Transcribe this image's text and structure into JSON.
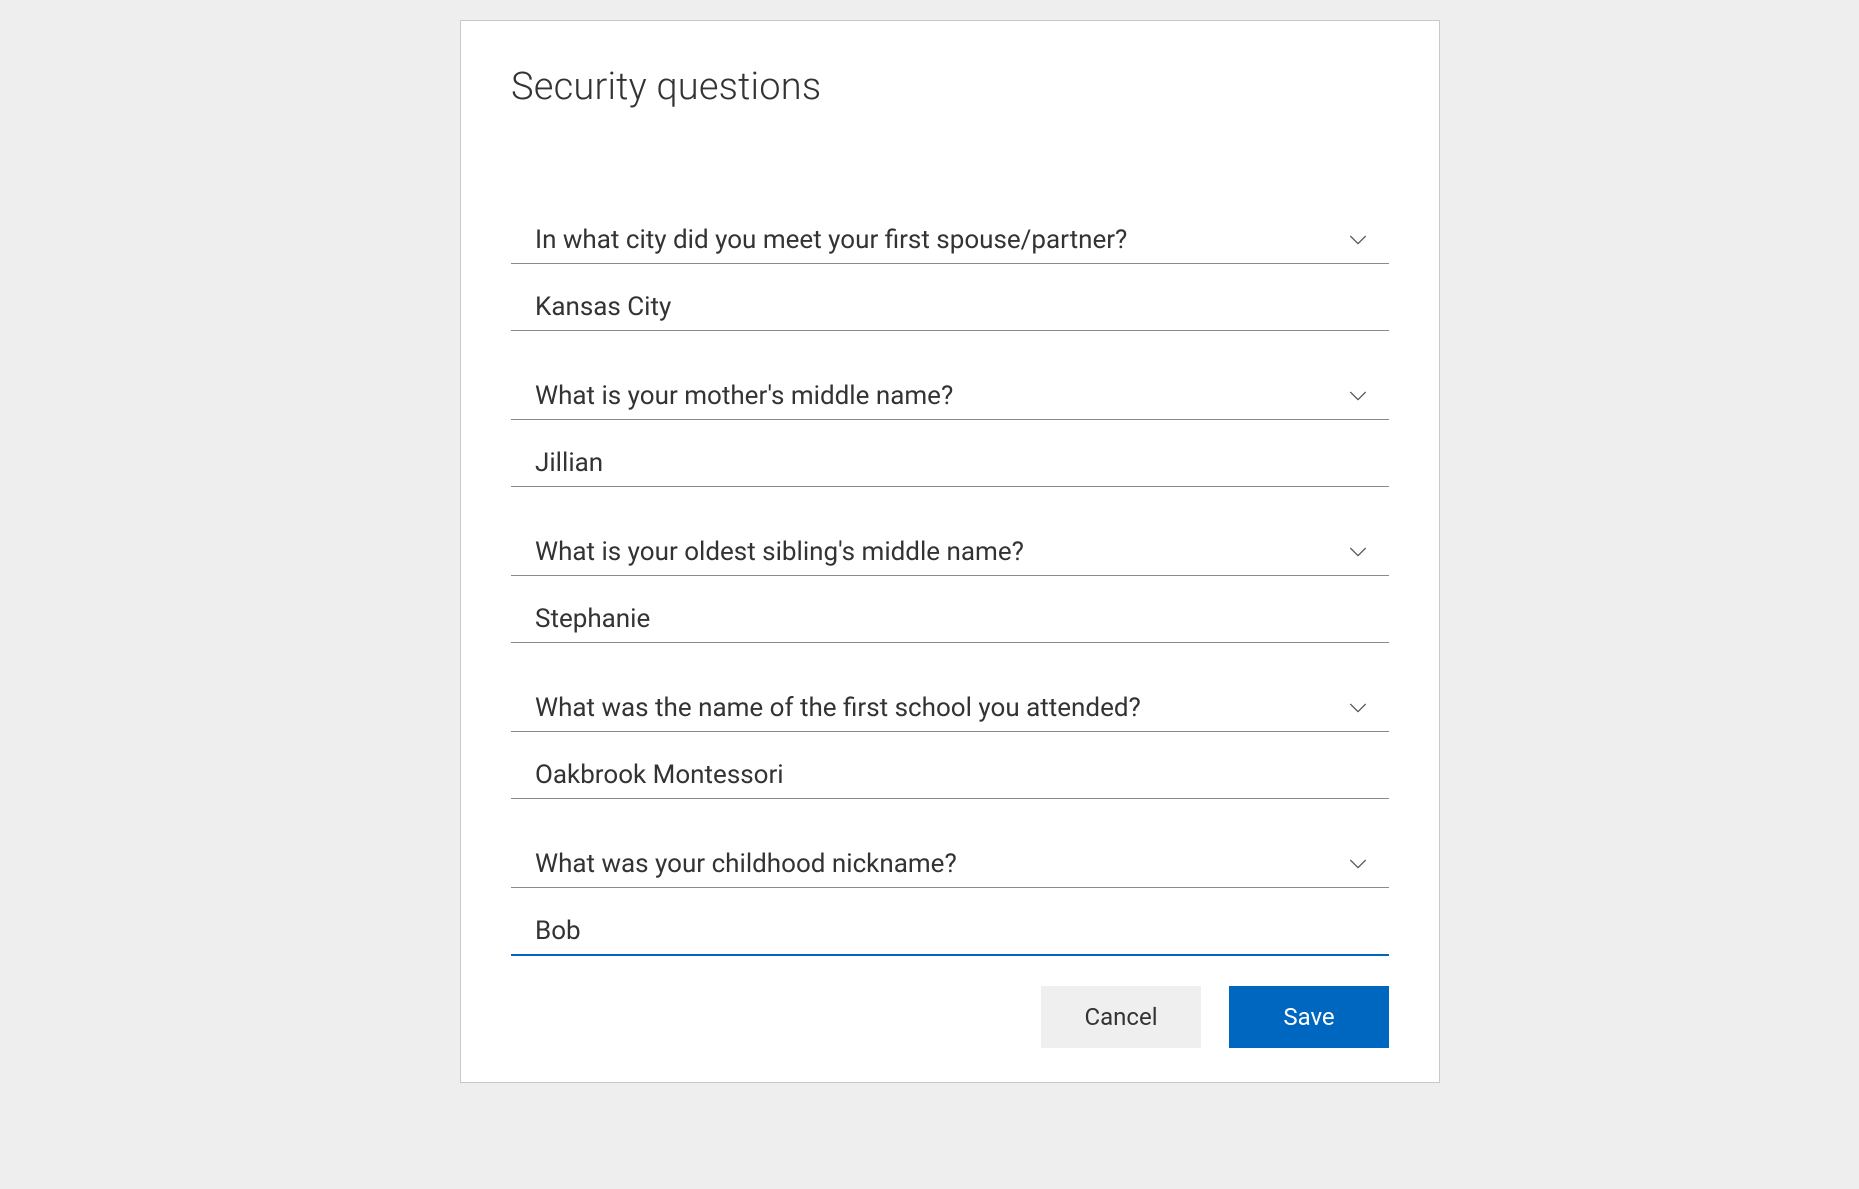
{
  "dialog": {
    "title": "Security questions",
    "questions": [
      {
        "question": "In what city did you meet your first spouse/partner?",
        "answer": "Kansas City",
        "focused": false
      },
      {
        "question": "What is your mother's middle name?",
        "answer": "Jillian",
        "focused": false
      },
      {
        "question": "What is your oldest sibling's middle name?",
        "answer": "Stephanie",
        "focused": false
      },
      {
        "question": "What was the name of the first school you attended?",
        "answer": "Oakbrook Montessori",
        "focused": false
      },
      {
        "question": "What was your childhood nickname?",
        "answer": "Bob",
        "focused": true
      }
    ],
    "buttons": {
      "cancel": "Cancel",
      "save": "Save"
    },
    "colors": {
      "primary": "#0067c0",
      "secondaryBg": "#efefef",
      "border": "#8a8a8a",
      "pageBg": "#eeeeee",
      "dialogBg": "#ffffff"
    }
  }
}
